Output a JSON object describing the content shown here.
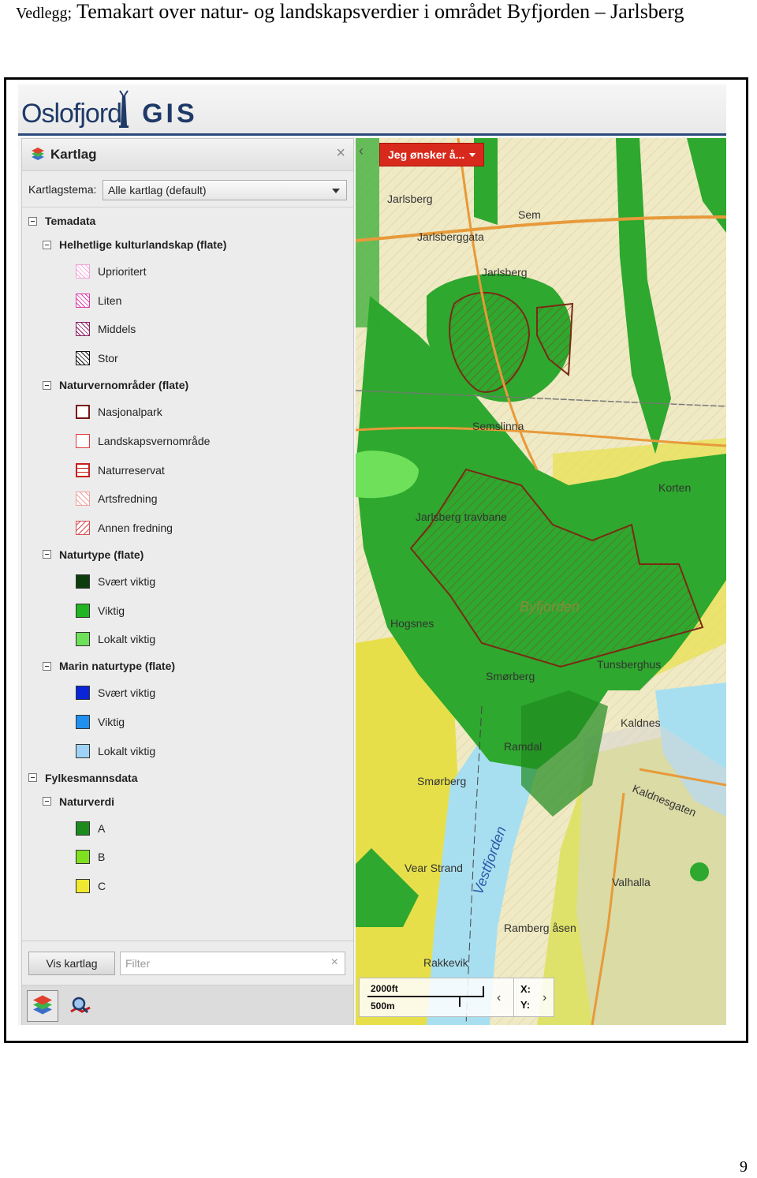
{
  "header": {
    "lead": "Vedlegg;",
    "title": "Temakart over natur- og landskapsverdier i området Byfjorden – Jarlsberg"
  },
  "page_number": "9",
  "app": {
    "logo_text": "Oslofjord",
    "logo_suffix": "GIS"
  },
  "panel": {
    "title": "Kartlag",
    "theme_label": "Kartlagstema:",
    "theme_value": "Alle kartlag (default)",
    "vis_button": "Vis kartlag",
    "filter_placeholder": "Filter"
  },
  "tree": [
    {
      "label": "Temadata",
      "level": 0,
      "type": "group"
    },
    {
      "label": "Helhetlige kulturlandskap (flate)",
      "level": 1,
      "type": "group"
    },
    {
      "label": "Uprioritert",
      "level": 2,
      "type": "layer",
      "style": "hatch-pink-light"
    },
    {
      "label": "Liten",
      "level": 2,
      "type": "layer",
      "style": "hatch-magenta"
    },
    {
      "label": "Middels",
      "level": 2,
      "type": "layer",
      "style": "hatch-purple"
    },
    {
      "label": "Stor",
      "level": 2,
      "type": "layer",
      "style": "hatch-black"
    },
    {
      "label": "Naturvernområder (flate)",
      "level": 1,
      "type": "group"
    },
    {
      "label": "Nasjonalpark",
      "level": 2,
      "type": "layer",
      "style": "outline-darkred"
    },
    {
      "label": "Landskapsvernområde",
      "level": 2,
      "type": "layer",
      "style": "outline-red"
    },
    {
      "label": "Naturreservat",
      "level": 2,
      "type": "layer",
      "style": "outline-red-lines"
    },
    {
      "label": "Artsfredning",
      "level": 2,
      "type": "layer",
      "style": "hatch-red-light"
    },
    {
      "label": "Annen fredning",
      "level": 2,
      "type": "layer",
      "style": "hatch-red-cross"
    },
    {
      "label": "Naturtype (flate)",
      "level": 1,
      "type": "group"
    },
    {
      "label": "Svært viktig",
      "level": 2,
      "type": "layer",
      "color": "#0d3d0d"
    },
    {
      "label": "Viktig",
      "level": 2,
      "type": "layer",
      "color": "#22b422"
    },
    {
      "label": "Lokalt viktig",
      "level": 2,
      "type": "layer",
      "color": "#6ee05a"
    },
    {
      "label": "Marin naturtype (flate)",
      "level": 1,
      "type": "group"
    },
    {
      "label": "Svært viktig",
      "level": 2,
      "type": "layer",
      "color": "#0a24d8"
    },
    {
      "label": "Viktig",
      "level": 2,
      "type": "layer",
      "color": "#1f8ff0"
    },
    {
      "label": "Lokalt viktig",
      "level": 2,
      "type": "layer",
      "color": "#9fd3f5"
    },
    {
      "label": "Fylkesmannsdata",
      "level": 0,
      "type": "group"
    },
    {
      "label": "Naturverdi",
      "level": 1,
      "type": "group"
    },
    {
      "label": "A",
      "level": 2,
      "type": "layer",
      "color": "#1c8a1c"
    },
    {
      "label": "B",
      "level": 2,
      "type": "layer",
      "color": "#7fe020"
    },
    {
      "label": "C",
      "level": 2,
      "type": "layer",
      "color": "#f0e830"
    }
  ],
  "map": {
    "menu_button": "Jeg ønsker å...",
    "scale_ft": "2000ft",
    "scale_m": "500m",
    "coord_x": "X:",
    "coord_y": "Y:",
    "labels": [
      "Jarlsberg",
      "Sem",
      "Jarlsberggata",
      "Jarlsberg",
      "Semslinna",
      "Korten",
      "Jarlsberg travbane",
      "Byfjorden",
      "Hogsnes",
      "Smørberg",
      "Tunsberghus",
      "Kaldnes",
      "Ramdal",
      "Smørberg",
      "Kaldnesgaten",
      "Vestfjorden",
      "Vear Strand",
      "Valhalla",
      "Ramberg åsen",
      "Rakkevik"
    ]
  }
}
